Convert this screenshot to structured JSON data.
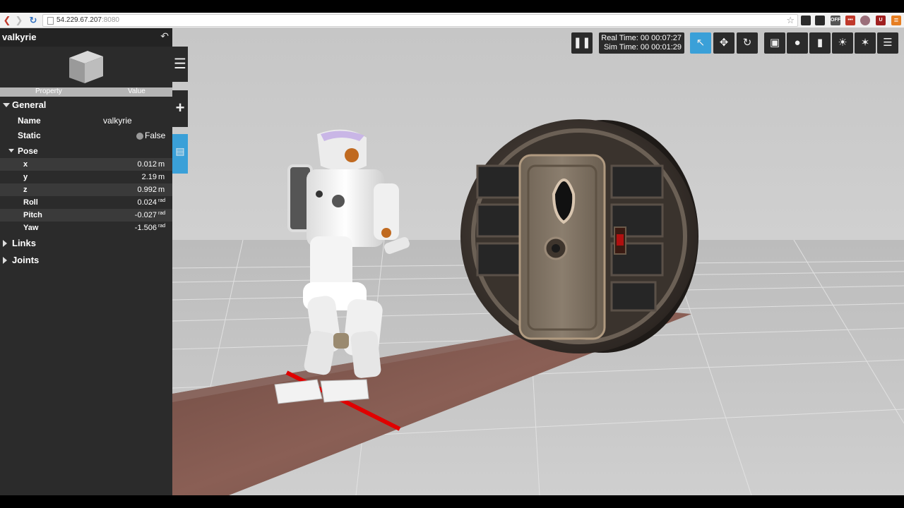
{
  "browser": {
    "url_host": "54.229.67.207",
    "url_port": ":8080",
    "extensions": [
      {
        "name": "evernote-icon",
        "color": "#2b2b2b",
        "label": ""
      },
      {
        "name": "buffer-icon",
        "color": "#2b2b2b",
        "label": ""
      },
      {
        "name": "off-icon",
        "color": "#555555",
        "label": "OFF"
      },
      {
        "name": "lastpass-icon",
        "color": "#c0392b",
        "label": "•••"
      },
      {
        "name": "dot-icon",
        "color": "#9b6f7a",
        "label": ""
      },
      {
        "name": "ublock-icon",
        "color": "#a02020",
        "label": "U"
      },
      {
        "name": "menu-icon",
        "color": "#e67e22",
        "label": "≡"
      }
    ]
  },
  "panel": {
    "title": "valkyrie",
    "columns": {
      "property": "Property",
      "value": "Value"
    },
    "general": {
      "label": "General",
      "name": {
        "label": "Name",
        "value": "valkyrie"
      },
      "static": {
        "label": "Static",
        "value": "False"
      }
    },
    "pose": {
      "label": "Pose",
      "x": {
        "label": "x",
        "value": "0.012",
        "unit": "m"
      },
      "y": {
        "label": "y",
        "value": "2.19",
        "unit": "m"
      },
      "z": {
        "label": "z",
        "value": "0.992",
        "unit": "m"
      },
      "roll": {
        "label": "Roll",
        "value": "0.024",
        "unit": "rad"
      },
      "pitch": {
        "label": "Pitch",
        "value": "-0.027",
        "unit": "rad"
      },
      "yaw": {
        "label": "Yaw",
        "value": "-1.506",
        "unit": "rad"
      }
    },
    "links": {
      "label": "Links"
    },
    "joints": {
      "label": "Joints"
    }
  },
  "toolbar": {
    "real_time": "Real Time: 00 00:07:27",
    "sim_time": "Sim Time: 00 00:01:29",
    "accent": "#3aa0d8"
  }
}
